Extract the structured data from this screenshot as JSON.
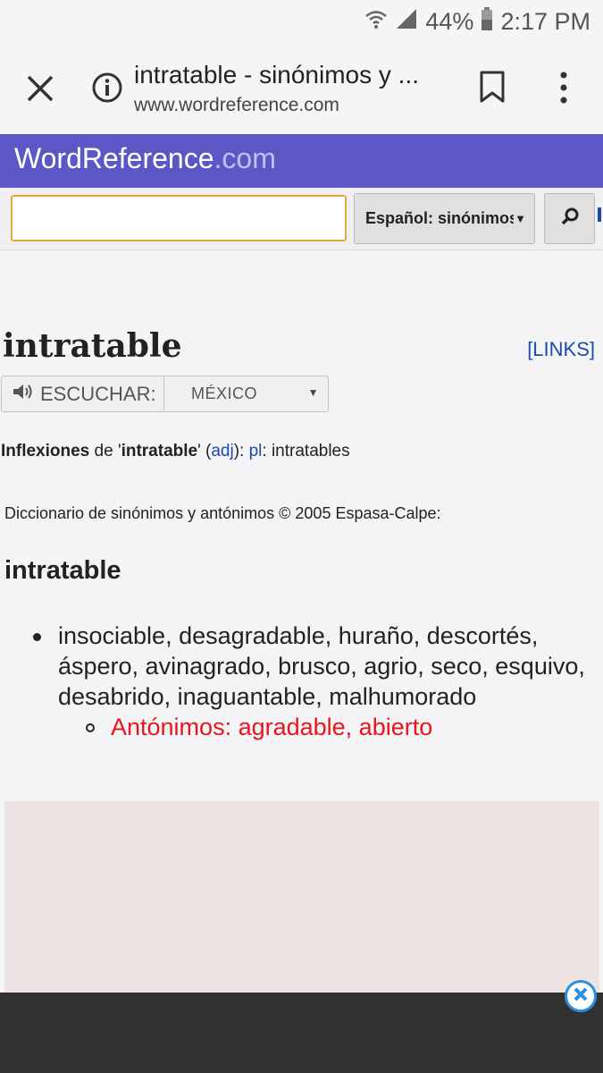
{
  "status_bar": {
    "battery": "44%",
    "time": "2:17 PM",
    "icons": [
      "wifi-icon",
      "signal-icon",
      "battery-icon"
    ]
  },
  "browser": {
    "page_title": "intratable - sinónimos y ...",
    "url": "www.wordreference.com",
    "icons": [
      "close-icon",
      "info-icon",
      "bookmark-icon",
      "more-vert-icon"
    ]
  },
  "site": {
    "logo_main": "WordReference",
    "logo_domain": ".com",
    "search_placeholder": "",
    "dictionary_select": "Español: sinónimos",
    "accent_color": "#5b58c5"
  },
  "entry": {
    "headword": "intratable",
    "links_label": "[LINKS]",
    "listen_label": "ESCUCHAR:",
    "accent_select": "MÉXICO",
    "inflections": {
      "label": "Inflexiones",
      "de": " de '",
      "word": "intratable",
      "after_word": "' (",
      "pos": "adj",
      "after_pos": "): ",
      "number": "pl",
      "after_number": ": intratables"
    },
    "source": "Diccionario de sinónimos y antónimos © 2005 Espasa-Calpe:",
    "sense_word": "intratable",
    "synonyms": "insociable, desagradable, huraño, descortés, áspero, avinagrado, brusco, agrio, seco, esquivo, desabrido, inaguantable, malhumorado",
    "antonyms": "Antónimos: agradable, abierto",
    "antonym_color": "#e8161c"
  }
}
